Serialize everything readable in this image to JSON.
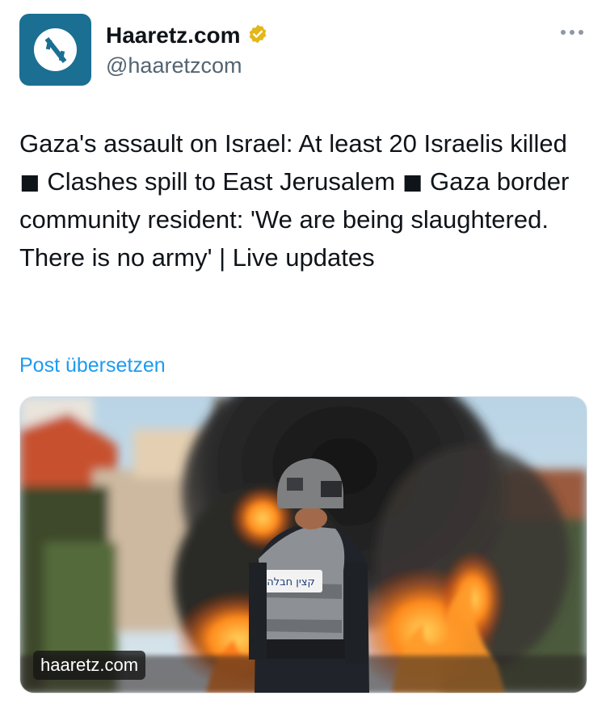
{
  "author": {
    "display_name": "Haaretz.com",
    "handle": "@haaretzcom",
    "verified_badge_icon": "gold-verified-check-icon",
    "avatar_icon": "haaretz-aleph-logo-icon"
  },
  "more_icon": "more-horizontal-icon",
  "tweet": {
    "text": "Gaza's assault on Israel: At least 20 Israelis killed ◼ Clashes spill to East Jerusalem ◼ Gaza border community resident: 'We are being slaughtered. There is no army' | Live updates",
    "translate_label": "Post übersetzen"
  },
  "media": {
    "source_label": "haaretz.com",
    "vest_label": "קצין חבלה"
  },
  "colors": {
    "avatar_bg": "#1a6f93",
    "link_blue": "#1d9bf0",
    "verified_gold": "#e2b719",
    "secondary_text": "#536471"
  }
}
